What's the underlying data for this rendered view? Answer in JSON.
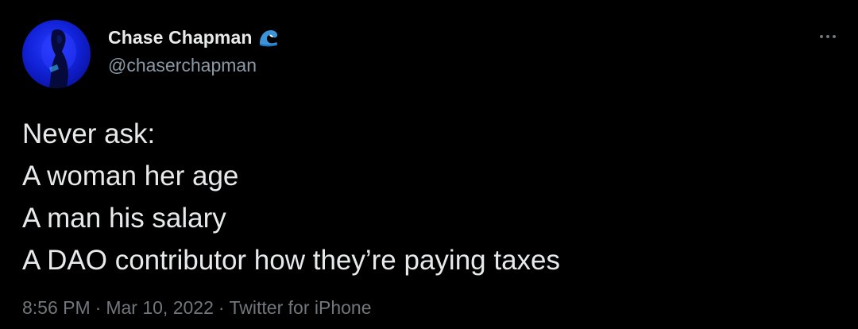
{
  "author": {
    "display_name": "Chase Chapman",
    "handle": "@chaserchapman",
    "badge_emoji": "water-wave-emoji"
  },
  "tweet": {
    "lines": [
      "Never ask:",
      "A woman her age",
      "A man his salary",
      "A DAO contributor how they’re paying taxes"
    ]
  },
  "meta": {
    "time": "8:56 PM",
    "separator": "·",
    "date": "Mar 10, 2022",
    "source": "Twitter for iPhone"
  },
  "colors": {
    "background": "#000000",
    "primary_text": "#e7e9ea",
    "secondary_text": "#71767b",
    "avatar_blue": "#1122d8"
  },
  "icons": {
    "more": "more-horizontal-icon"
  }
}
